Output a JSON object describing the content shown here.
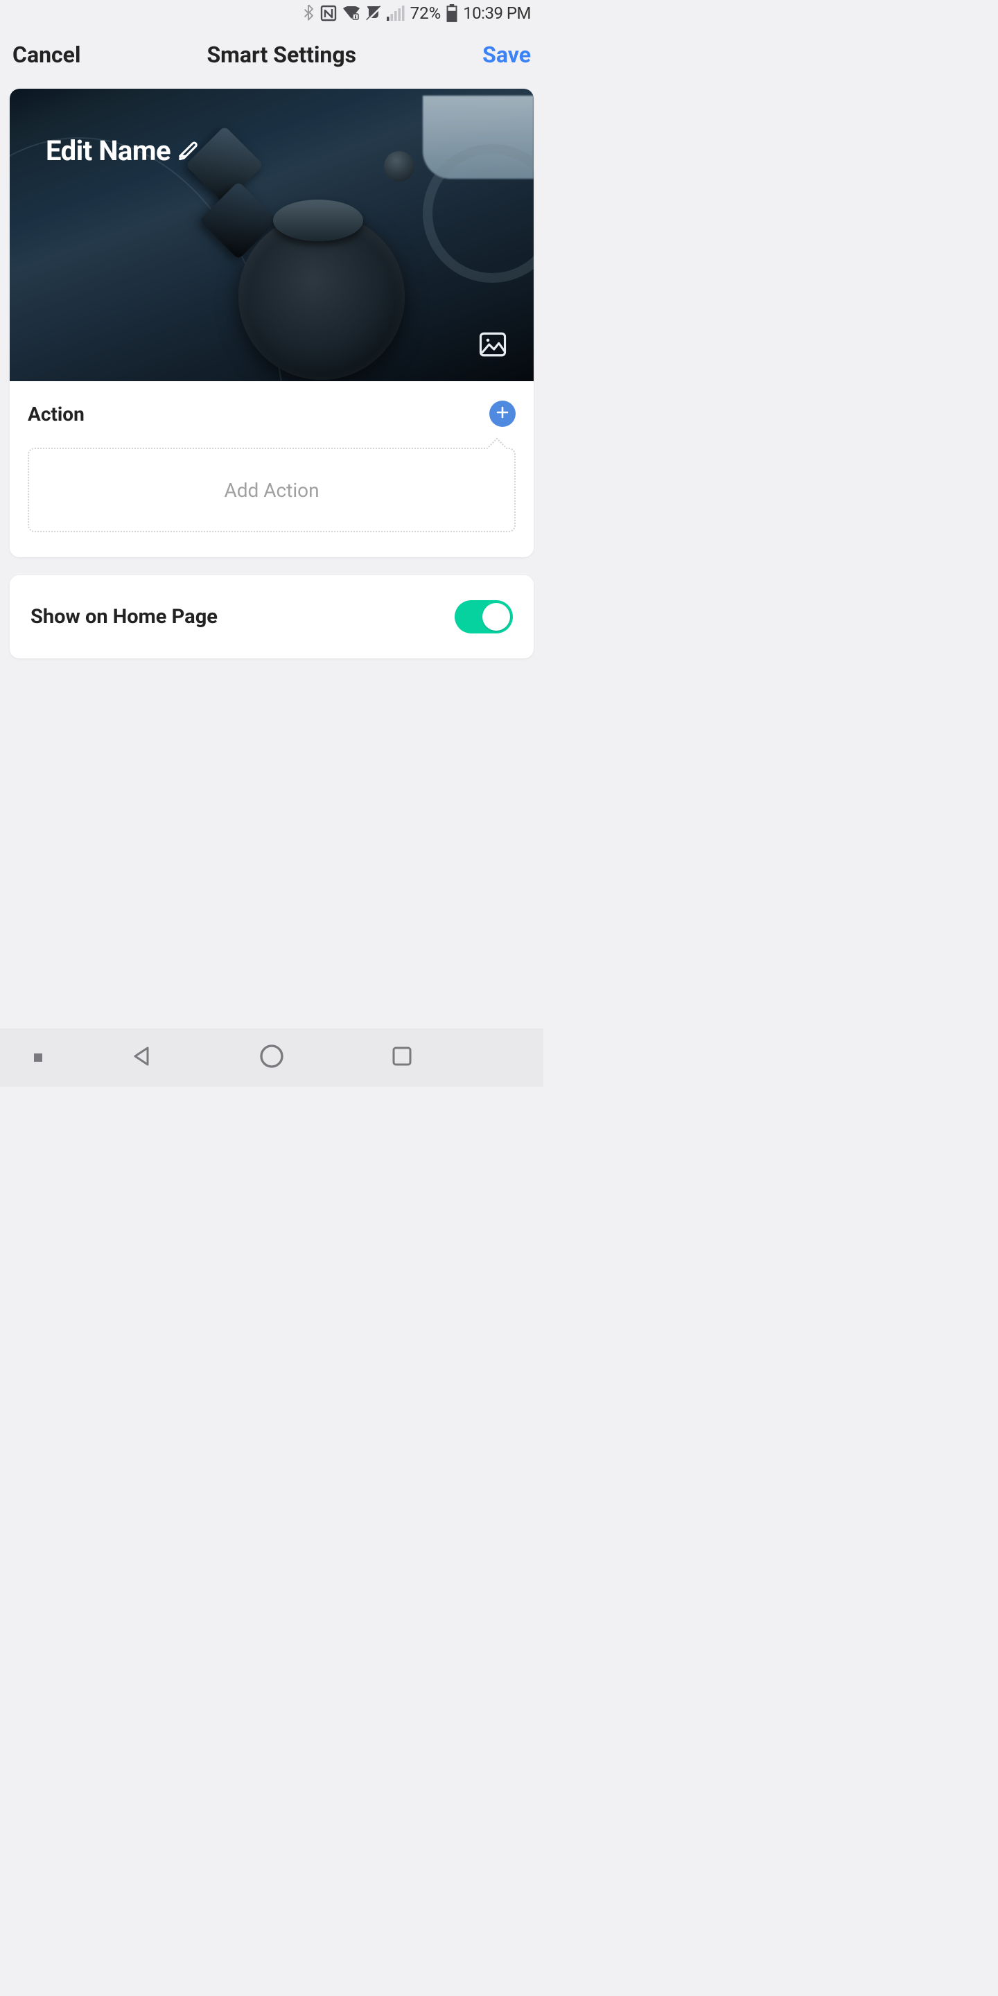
{
  "status": {
    "battery_percent": "72%",
    "time": "10:39 PM"
  },
  "header": {
    "cancel": "Cancel",
    "title": "Smart Settings",
    "save": "Save"
  },
  "hero": {
    "edit_name_label": "Edit Name"
  },
  "action": {
    "heading": "Action",
    "placeholder": "Add Action"
  },
  "home_toggle": {
    "label": "Show on Home Page",
    "enabled": true
  },
  "colors": {
    "accent_blue": "#3b82f6",
    "plus_blue": "#4f8ae0",
    "toggle_green": "#06d2a0"
  }
}
